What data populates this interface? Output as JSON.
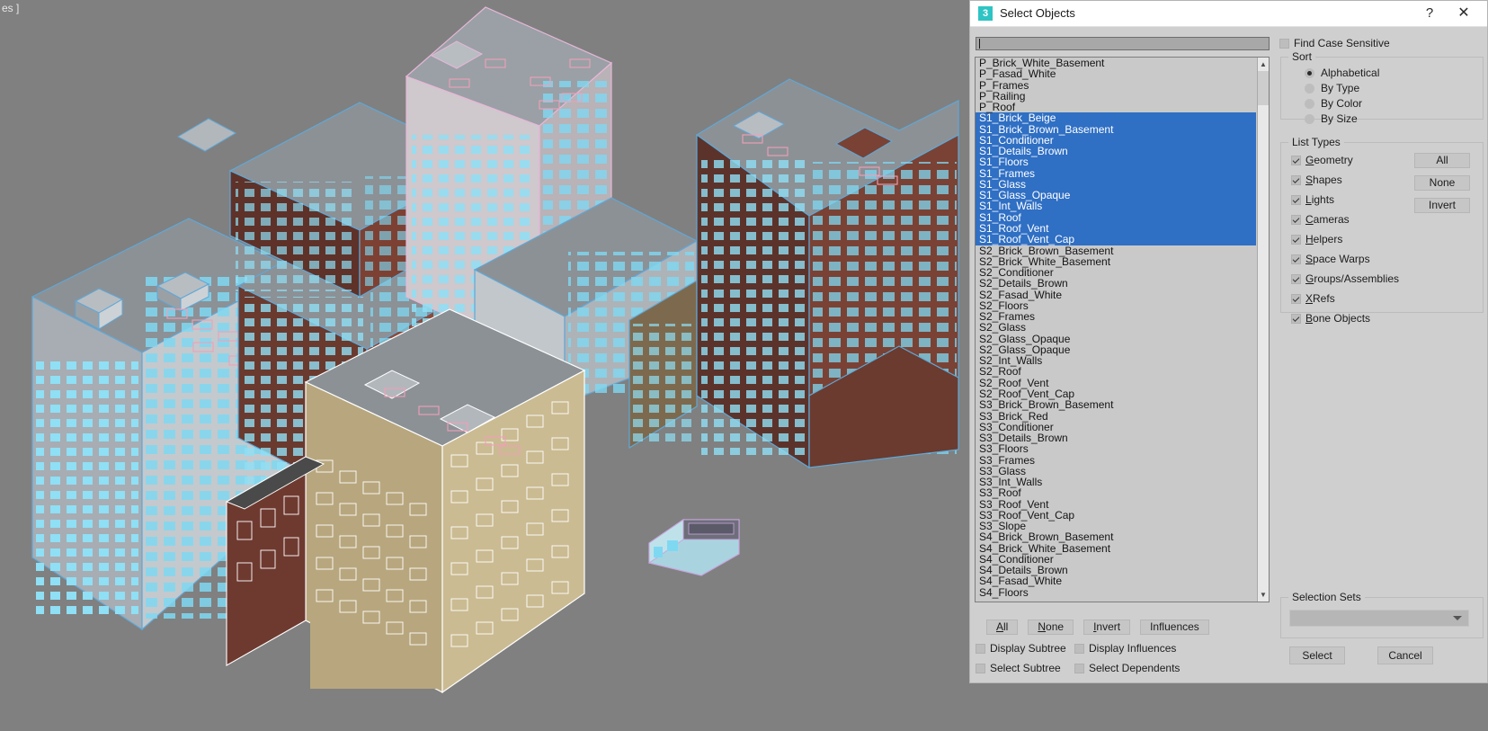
{
  "viewport": {
    "label": "es ]",
    "background_color": "#808080",
    "scene_description": "Isometric shaded+wireframe 3D view of a residential complex: several multi-storey apartment blocks with cyan glazed windows, brown/beige/white/pink brick facades, grey roofs with rooftop equipment and railings, plus a small bus model in the foreground."
  },
  "dialog": {
    "title": "Select Objects",
    "icon": "max-3-icon",
    "help_glyph": "?",
    "close_glyph": "✕",
    "search": {
      "value": "",
      "placeholder": ""
    },
    "find_case_sensitive": {
      "label": "Find Case Sensitive",
      "checked": false
    },
    "sort": {
      "title": "Sort",
      "options": [
        {
          "label": "Alphabetical",
          "selected": true
        },
        {
          "label": "By Type",
          "selected": false
        },
        {
          "label": "By Color",
          "selected": false
        },
        {
          "label": "By Size",
          "selected": false
        }
      ]
    },
    "list_types": {
      "title": "List Types",
      "checkboxes": [
        {
          "label": "Geometry",
          "checked": true
        },
        {
          "label": "Shapes",
          "checked": true
        },
        {
          "label": "Lights",
          "checked": true
        },
        {
          "label": "Cameras",
          "checked": true
        },
        {
          "label": "Helpers",
          "checked": true
        },
        {
          "label": "Space Warps",
          "checked": true
        },
        {
          "label": "Groups/Assemblies",
          "checked": true
        },
        {
          "label": "XRefs",
          "checked": true
        },
        {
          "label": "Bone Objects",
          "checked": true
        }
      ],
      "buttons": [
        "All",
        "None",
        "Invert"
      ]
    },
    "object_list": [
      {
        "name": "P_Brick_White_Basement",
        "selected": false
      },
      {
        "name": "P_Fasad_White",
        "selected": false
      },
      {
        "name": "P_Frames",
        "selected": false
      },
      {
        "name": "P_Railing",
        "selected": false
      },
      {
        "name": "P_Roof",
        "selected": false
      },
      {
        "name": "S1_Brick_Beige",
        "selected": true
      },
      {
        "name": "S1_Brick_Brown_Basement",
        "selected": true
      },
      {
        "name": "S1_Conditioner",
        "selected": true
      },
      {
        "name": "S1_Details_Brown",
        "selected": true
      },
      {
        "name": "S1_Floors",
        "selected": true
      },
      {
        "name": "S1_Frames",
        "selected": true
      },
      {
        "name": "S1_Glass",
        "selected": true
      },
      {
        "name": "S1_Glass_Opaque",
        "selected": true
      },
      {
        "name": "S1_Int_Walls",
        "selected": true
      },
      {
        "name": "S1_Roof",
        "selected": true
      },
      {
        "name": "S1_Roof_Vent",
        "selected": true
      },
      {
        "name": "S1_Roof_Vent_Cap",
        "selected": true
      },
      {
        "name": "S2_Brick_Brown_Basement",
        "selected": false
      },
      {
        "name": "S2_Brick_White_Basement",
        "selected": false
      },
      {
        "name": "S2_Conditioner",
        "selected": false
      },
      {
        "name": "S2_Details_Brown",
        "selected": false
      },
      {
        "name": "S2_Fasad_White",
        "selected": false
      },
      {
        "name": "S2_Floors",
        "selected": false
      },
      {
        "name": "S2_Frames",
        "selected": false
      },
      {
        "name": "S2_Glass",
        "selected": false
      },
      {
        "name": "S2_Glass_Opaque",
        "selected": false
      },
      {
        "name": "S2_Glass_Opaque",
        "selected": false
      },
      {
        "name": "S2_Int_Walls",
        "selected": false
      },
      {
        "name": "S2_Roof",
        "selected": false
      },
      {
        "name": "S2_Roof_Vent",
        "selected": false
      },
      {
        "name": "S2_Roof_Vent_Cap",
        "selected": false
      },
      {
        "name": "S3_Brick_Brown_Basement",
        "selected": false
      },
      {
        "name": "S3_Brick_Red",
        "selected": false
      },
      {
        "name": "S3_Conditioner",
        "selected": false
      },
      {
        "name": "S3_Details_Brown",
        "selected": false
      },
      {
        "name": "S3_Floors",
        "selected": false
      },
      {
        "name": "S3_Frames",
        "selected": false
      },
      {
        "name": "S3_Glass",
        "selected": false
      },
      {
        "name": "S3_Int_Walls",
        "selected": false
      },
      {
        "name": "S3_Roof",
        "selected": false
      },
      {
        "name": "S3_Roof_Vent",
        "selected": false
      },
      {
        "name": "S3_Roof_Vent_Cap",
        "selected": false
      },
      {
        "name": "S3_Slope",
        "selected": false
      },
      {
        "name": "S4_Brick_Brown_Basement",
        "selected": false
      },
      {
        "name": "S4_Brick_White_Basement",
        "selected": false
      },
      {
        "name": "S4_Conditioner",
        "selected": false
      },
      {
        "name": "S4_Details_Brown",
        "selected": false
      },
      {
        "name": "S4_Fasad_White",
        "selected": false
      },
      {
        "name": "S4_Floors",
        "selected": false
      }
    ],
    "list_buttons": [
      {
        "label": "All",
        "accel": "A"
      },
      {
        "label": "None",
        "accel": "N"
      },
      {
        "label": "Invert",
        "accel": "I"
      },
      {
        "label": "Influences",
        "accel": ""
      }
    ],
    "bottom_checkboxes": [
      {
        "label": "Display Subtree",
        "checked": false
      },
      {
        "label": "Display Influences",
        "checked": false
      },
      {
        "label": "Select Subtree",
        "checked": false
      },
      {
        "label": "Select Dependents",
        "checked": false
      }
    ],
    "selection_sets": {
      "title": "Selection Sets",
      "value": ""
    },
    "actions": {
      "select": "Select",
      "cancel": "Cancel"
    },
    "colors": {
      "selection_blue": "#2f6fc4",
      "dialog_bg": "#cfcfcf",
      "list_bg": "#c9c9c9",
      "titlebar_bg": "#ffffff",
      "icon_teal": "#2ec4c4"
    }
  }
}
